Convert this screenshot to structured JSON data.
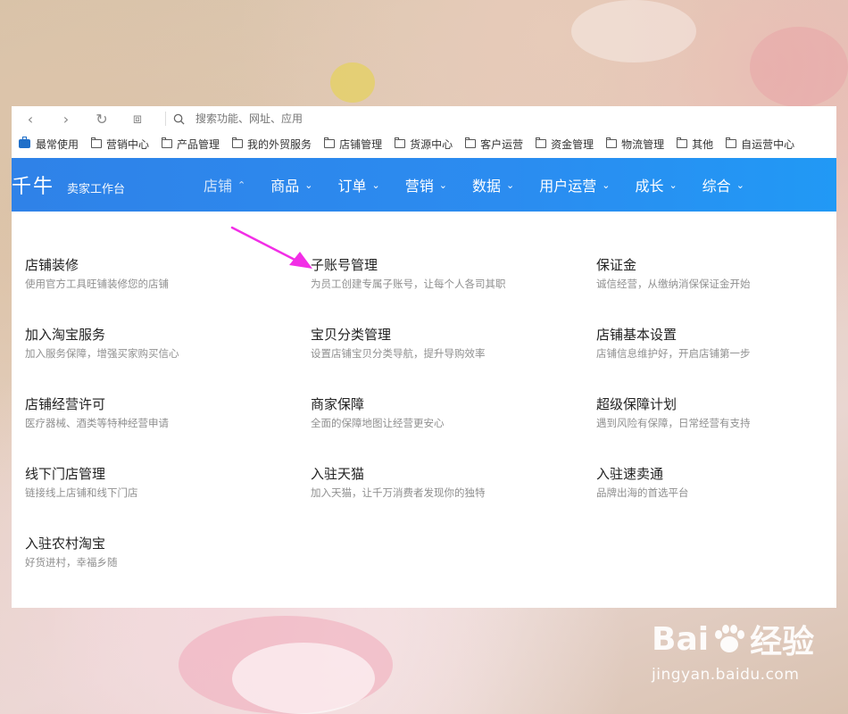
{
  "browser": {
    "search_placeholder": "搜索功能、网址、应用",
    "bookmarks": [
      "最常使用",
      "营销中心",
      "产品管理",
      "我的外贸服务",
      "店铺管理",
      "货源中心",
      "客户运营",
      "资金管理",
      "物流管理",
      "其他",
      "自运营中心"
    ]
  },
  "navbar": {
    "brand": "千牛",
    "subbrand": "卖家工作台",
    "menu": [
      "店铺",
      "商品",
      "订单",
      "营销",
      "数据",
      "用户运营",
      "成长",
      "综合"
    ],
    "active_index": 0
  },
  "entries": [
    {
      "title": "店铺装修",
      "desc": "使用官方工具旺铺装修您的店铺"
    },
    {
      "title": "子账号管理",
      "desc": "为员工创建专属子账号，让每个人各司其职"
    },
    {
      "title": "保证金",
      "desc": "诚信经营，从缴纳消保保证金开始"
    },
    {
      "title": "加入淘宝服务",
      "desc": "加入服务保障，增强买家购买信心"
    },
    {
      "title": "宝贝分类管理",
      "desc": "设置店铺宝贝分类导航，提升导购效率"
    },
    {
      "title": "店铺基本设置",
      "desc": "店铺信息维护好，开启店铺第一步"
    },
    {
      "title": "店铺经营许可",
      "desc": "医疗器械、酒类等特种经营申请"
    },
    {
      "title": "商家保障",
      "desc": "全面的保障地图让经营更安心"
    },
    {
      "title": "超级保障计划",
      "desc": "遇到风险有保障，日常经营有支持"
    },
    {
      "title": "线下门店管理",
      "desc": "链接线上店铺和线下门店"
    },
    {
      "title": "入驻天猫",
      "desc": "加入天猫，让千万消费者发现你的独特"
    },
    {
      "title": "入驻速卖通",
      "desc": "品牌出海的首选平台"
    },
    {
      "title": "入驻农村淘宝",
      "desc": "好货进村，幸福乡随"
    }
  ],
  "watermark": {
    "main_left": "Bai",
    "main_right": "经验",
    "sub": "jingyan.baidu.com"
  },
  "colors": {
    "nav_start": "#2f82e8",
    "nav_end": "#2199f5",
    "arrow": "#f22ee6"
  }
}
